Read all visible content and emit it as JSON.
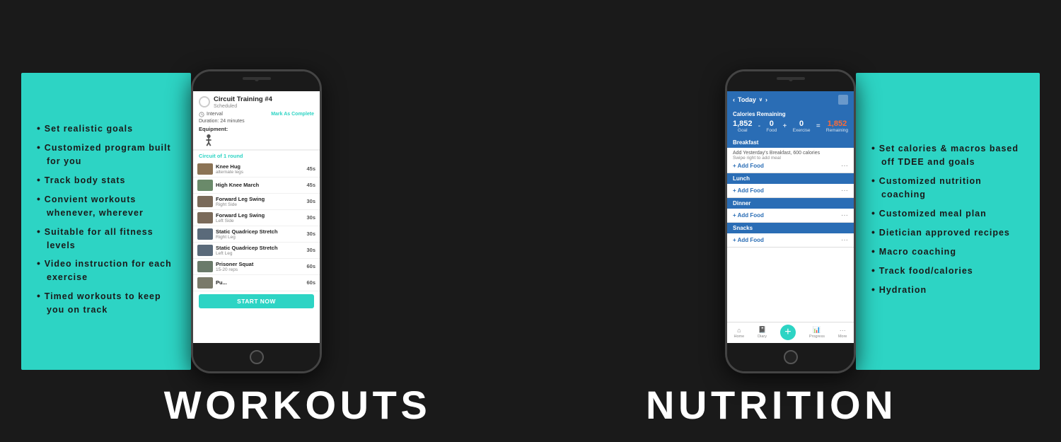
{
  "page": {
    "background": "#1a1a1a"
  },
  "workouts": {
    "section_title": "WORKOUTS",
    "features": [
      "Set realistic goals",
      "Customized program built for you",
      "Track body stats",
      "Convient workouts whenever, wherever",
      " Suitable for all fitness levels",
      "Video instruction for each exercise",
      "Timed workouts to keep you on track"
    ],
    "app_screen": {
      "title": "Circuit Training #4",
      "status": "Scheduled",
      "interval_label": "Interval",
      "mark_complete": "Mark As Complete",
      "duration": "Duration: 24 minutes",
      "equipment_label": "Equipment:",
      "body_weight": "Body Weight",
      "circuit_label": "Circuit of 1 round",
      "exercises": [
        {
          "name": "Knee Hug",
          "sub": "alternate legs",
          "duration": "45s"
        },
        {
          "name": "High Knee March",
          "sub": "",
          "duration": "45s"
        },
        {
          "name": "Forward Leg Swing",
          "sub": "Right Side",
          "duration": "30s"
        },
        {
          "name": "Forward Leg Swing",
          "sub": "Left Side",
          "duration": "30s"
        },
        {
          "name": "Static Quadricep Stretch",
          "sub": "Right Leg",
          "duration": "30s"
        },
        {
          "name": "Static Quadricep Stretch",
          "sub": "Left Leg",
          "duration": "30s"
        },
        {
          "name": "Prisoner Squat",
          "sub": "15-20 reps",
          "duration": "60s"
        },
        {
          "name": "Pu...",
          "sub": "",
          "duration": "60s"
        }
      ],
      "start_button": "START NOW"
    }
  },
  "nutrition": {
    "section_title": "NUTRITION",
    "features": [
      "Set calories & macros based off TDEE and goals",
      "Customized nutrition coaching",
      "Customized meal plan",
      "Dietician approved recipes",
      "Macro coaching",
      "Track food/calories",
      "Hydration"
    ],
    "app_screen": {
      "today_label": "Today",
      "calories_remaining_label": "Calories Remaining",
      "goal": "1,852",
      "food": "0",
      "exercise": "0",
      "remaining": "1,852",
      "goal_label": "Goal",
      "food_label": "Food",
      "exercise_label": "Exercise",
      "remaining_label": "Remaining",
      "meals": [
        {
          "name": "Breakfast",
          "suggestion": "Add Yesterday's Breakfast, 600 calories",
          "hint": "Swipe right to add meal"
        },
        {
          "name": "Lunch",
          "suggestion": ""
        },
        {
          "name": "Dinner",
          "suggestion": ""
        },
        {
          "name": "Snacks",
          "suggestion": ""
        }
      ],
      "add_food_label": "+ Add Food",
      "nav_items": [
        "Home",
        "Diary",
        "",
        "Progress",
        "More"
      ]
    }
  }
}
